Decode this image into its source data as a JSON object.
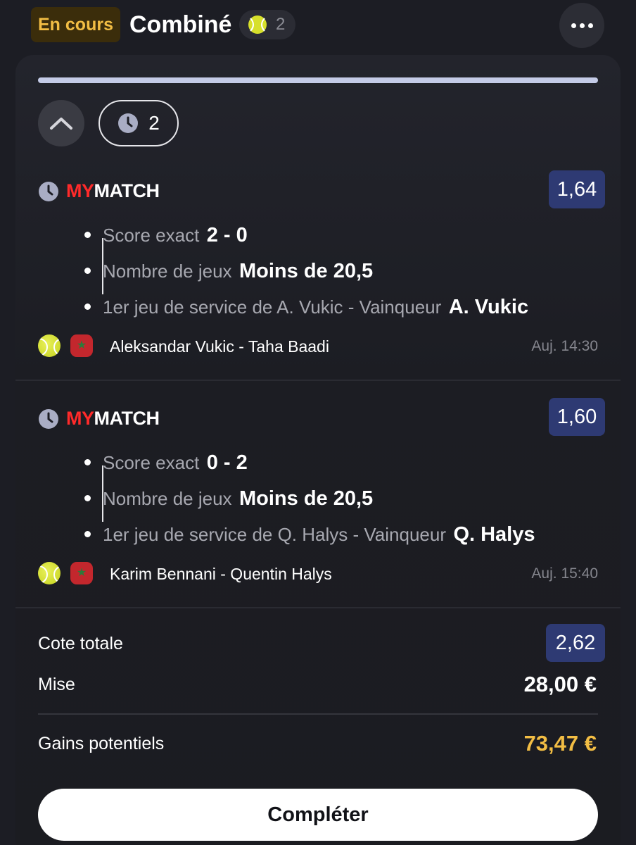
{
  "header": {
    "status": "En cours",
    "bet_type": "Combiné",
    "sport_icon": "tennis-ball-icon",
    "selection_count": "2",
    "more_icon": "more-icon"
  },
  "card": {
    "progress": 1.0,
    "pending_count": "2",
    "selections": [
      {
        "brand_my": "MY",
        "brand_match": "MATCH",
        "odds": "1,64",
        "legs": [
          {
            "label": "Score exact",
            "value": "2 - 0"
          },
          {
            "label": "Nombre de jeux",
            "value": "Moins de 20,5"
          },
          {
            "label": "1er jeu de service de A. Vukic - Vainqueur",
            "value": "A. Vukic"
          }
        ],
        "match": "Aleksandar Vukic - Taha Baadi",
        "time": "Auj. 14:30"
      },
      {
        "brand_my": "MY",
        "brand_match": "MATCH",
        "odds": "1,60",
        "legs": [
          {
            "label": "Score exact",
            "value": "0 - 2"
          },
          {
            "label": "Nombre de jeux",
            "value": "Moins de 20,5"
          },
          {
            "label": "1er jeu de service de Q. Halys - Vainqueur",
            "value": "Q. Halys"
          }
        ],
        "match": "Karim Bennani - Quentin Halys",
        "time": "Auj. 15:40"
      }
    ]
  },
  "summary": {
    "total_odds_label": "Cote totale",
    "total_odds": "2,62",
    "stake_label": "Mise",
    "stake": "28,00 €",
    "gains_label": "Gains potentiels",
    "gains": "73,47 €"
  },
  "action": {
    "complete_label": "Compléter"
  },
  "colors": {
    "background": "#1c1d24",
    "accent_gold": "#f2bd44",
    "odds_badge": "#2e3a73",
    "brand_red": "#ff2a2a"
  }
}
